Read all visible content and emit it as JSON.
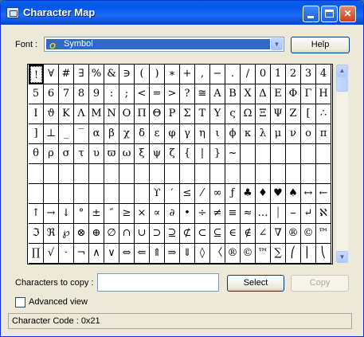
{
  "window": {
    "title": "Character Map"
  },
  "font": {
    "label": "Font :",
    "selected": "Symbol",
    "icon": "O"
  },
  "buttons": {
    "help": "Help",
    "select": "Select",
    "copy": "Copy"
  },
  "copy": {
    "label": "Characters to copy :",
    "value": ""
  },
  "advanced": {
    "label": "Advanced view"
  },
  "status": {
    "text": "Character Code : 0x21"
  },
  "glyphs": [
    [
      "!",
      "∀",
      "#",
      "∃",
      "%",
      "&",
      "∋",
      "(",
      ")",
      "∗",
      "+",
      ",",
      "−",
      ".",
      "/",
      "0",
      "1",
      "2",
      "3",
      "4"
    ],
    [
      "5",
      "6",
      "7",
      "8",
      "9",
      ":",
      ";",
      "<",
      "=",
      ">",
      "?",
      "≅",
      "Α",
      "Β",
      "Χ",
      "Δ",
      "Ε",
      "Φ",
      "Γ",
      "Η"
    ],
    [
      "Ι",
      "ϑ",
      "Κ",
      "Λ",
      "Μ",
      "Ν",
      "Ο",
      "Π",
      "Θ",
      "Ρ",
      "Σ",
      "Τ",
      "Υ",
      "ς",
      "Ω",
      "Ξ",
      "Ψ",
      "Ζ",
      "[",
      "∴"
    ],
    [
      "]",
      "⊥",
      "_",
      "‾",
      "α",
      "β",
      "χ",
      "δ",
      "ε",
      "φ",
      "γ",
      "η",
      "ι",
      "ϕ",
      "κ",
      "λ",
      "μ",
      "ν",
      "ο",
      "π"
    ],
    [
      "θ",
      "ρ",
      "σ",
      "τ",
      "υ",
      "ϖ",
      "ω",
      "ξ",
      "ψ",
      "ζ",
      "{",
      "|",
      "}",
      "~",
      "",
      "",
      "",
      "",
      "",
      ""
    ],
    [
      "",
      "",
      "",
      "",
      "",
      "",
      "",
      "",
      "",
      "",
      "",
      "",
      "",
      "",
      "",
      "",
      "",
      "",
      "",
      ""
    ],
    [
      "",
      "",
      "",
      "",
      "",
      "",
      "",
      "",
      "ϒ",
      "′",
      "≤",
      "⁄",
      "∞",
      "ƒ",
      "♣",
      "♦",
      "♥",
      "♠",
      "↔",
      "←"
    ],
    [
      "↑",
      "→",
      "↓",
      "°",
      "±",
      "″",
      "≥",
      "×",
      "∝",
      "∂",
      "•",
      "÷",
      "≠",
      "≡",
      "≈",
      "…",
      "⏐",
      "⎯",
      "↵",
      "ℵ"
    ],
    [
      "ℑ",
      "ℜ",
      "℘",
      "⊗",
      "⊕",
      "∅",
      "∩",
      "∪",
      "⊃",
      "⊇",
      "⊄",
      "⊂",
      "⊆",
      "∈",
      "∉",
      "∠",
      "∇",
      "®",
      "©",
      "™"
    ],
    [
      "∏",
      "√",
      "⋅",
      "¬",
      "∧",
      "∨",
      "⇔",
      "⇐",
      "⇑",
      "⇒",
      "⇓",
      "◊",
      "〈",
      "®",
      "©",
      "™",
      "∑",
      "⎛",
      "⎜",
      "⎝"
    ]
  ]
}
